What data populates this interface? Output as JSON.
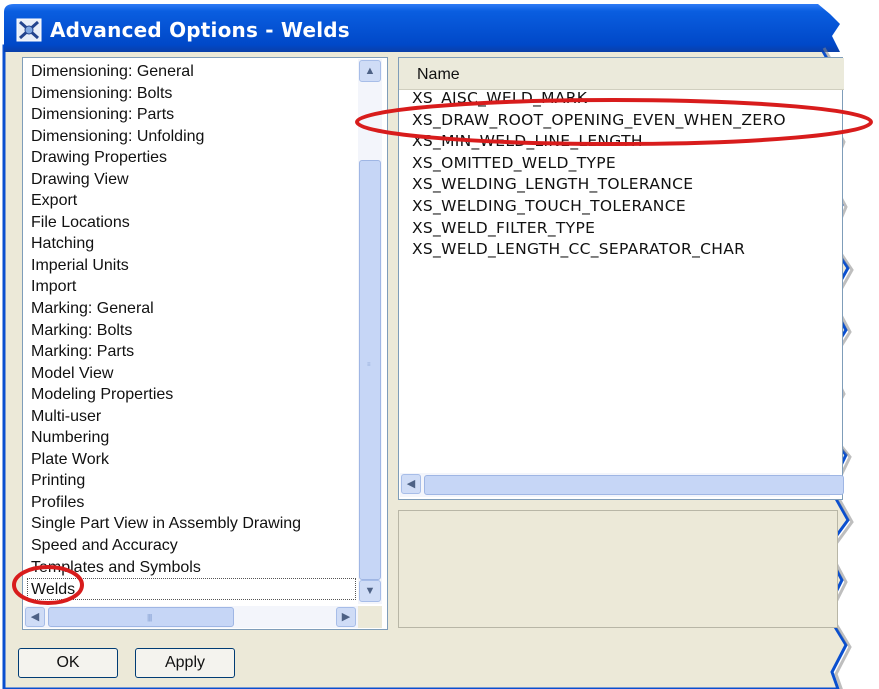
{
  "window": {
    "title": "Advanced Options - Welds",
    "icon": "advanced-options-app-icon"
  },
  "categories": {
    "items": [
      "Dimensioning: General",
      "Dimensioning: Bolts",
      "Dimensioning: Parts",
      "Dimensioning: Unfolding",
      "Drawing Properties",
      "Drawing View",
      "Export",
      "File Locations",
      "Hatching",
      "Imperial Units",
      "Import",
      "Marking: General",
      "Marking: Bolts",
      "Marking: Parts",
      "Model View",
      "Modeling Properties",
      "Multi-user",
      "Numbering",
      "Plate Work",
      "Printing",
      "Profiles",
      "Single Part View in Assembly Drawing",
      "Speed and Accuracy",
      "Templates and Symbols",
      "Welds"
    ],
    "selected": "Welds"
  },
  "names_panel": {
    "header": "Name",
    "items": [
      "XS_AISC_WELD_MARK",
      "XS_DRAW_ROOT_OPENING_EVEN_WHEN_ZERO",
      "XS_MIN_WELD_LINE_LENGTH",
      "XS_OMITTED_WELD_TYPE",
      "XS_WELDING_LENGTH_TOLERANCE",
      "XS_WELDING_TOUCH_TOLERANCE",
      "XS_WELD_FILTER_TYPE",
      "XS_WELD_LENGTH_CC_SEPARATOR_CHAR"
    ]
  },
  "buttons": {
    "ok": "OK",
    "apply": "Apply"
  },
  "colors": {
    "title_bar": "#0a4fcf",
    "window_bg": "#ece9d8",
    "annotation": "#d81c1c"
  }
}
